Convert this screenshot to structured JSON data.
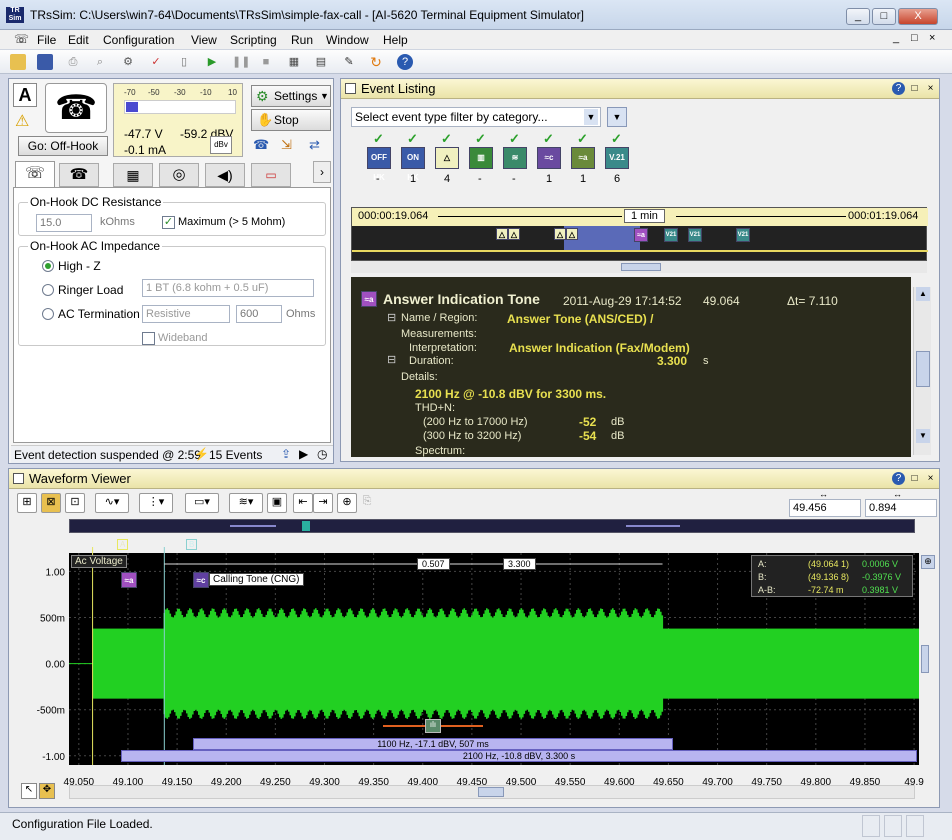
{
  "window": {
    "logo": "TR Sim",
    "title": "TRsSim:  C:\\Users\\win7-64\\Documents\\TRsSim\\simple-fax-call - [AI-5620  Terminal Equipment Simulator]",
    "min": "_",
    "max": "□",
    "close": "X"
  },
  "menu": [
    "File",
    "Edit",
    "Configuration",
    "View",
    "Scripting",
    "Run",
    "Window",
    "Help"
  ],
  "mdi_buttons": [
    "_",
    "□",
    "×"
  ],
  "left_panel": {
    "a_label": "A",
    "go_button": "Go:  Off-Hook",
    "meter_ticks": [
      "-70",
      "-50",
      "-30",
      "-10",
      "10"
    ],
    "voltage": "-47.7  V",
    "current": "-0.1 mA",
    "dbv": "-59.2 dBV",
    "dbv_btn": "dBv",
    "settings_button": "Settings",
    "stop_button": "Stop",
    "dc_group": {
      "title": "On-Hook DC Resistance",
      "value": "15.0",
      "unit": "kOhms",
      "maximum_label": "Maximum (> 5 Mohm)"
    },
    "ac_group": {
      "title": "On-Hook AC Impedance",
      "options": [
        "High - Z",
        "Ringer Load",
        "AC Termination"
      ],
      "ringer_value": "1 BT (6.8 kohm + 0.5 uF)",
      "termination_value": "Resistive",
      "termination_ohms": "600",
      "ohms_unit": "Ohms",
      "wideband_label": "Wideband"
    },
    "status_text": "Event detection suspended @ 2:59",
    "events_count": "15 Events"
  },
  "event_listing": {
    "title": "Event Listing",
    "filter_placeholder": "Select event type filter by category...",
    "categories": [
      {
        "icon": "OFF HK",
        "count": "-"
      },
      {
        "icon": "ON HK",
        "count": "1"
      },
      {
        "icon": "△",
        "count": "4"
      },
      {
        "icon": "▥",
        "count": "-"
      },
      {
        "icon": "≋",
        "count": "-"
      },
      {
        "icon": "≈c",
        "count": "1"
      },
      {
        "icon": "≈a",
        "count": "1"
      },
      {
        "icon": "V.21",
        "count": "6"
      }
    ],
    "timeline_start": "000:00:19.064",
    "timeline_span": "1 min",
    "timeline_end": "000:01:19.064",
    "detail": {
      "name": "Answer Indication Tone",
      "date": "2011-Aug-29  17:14:52",
      "time": "49.064",
      "delta": "Δt= 7.110",
      "name_region_label": "Name / Region:",
      "name_region_value": "Answer Tone (ANS/CED)  /",
      "measurements_label": "Measurements:",
      "interpretation_label": "Interpretation:",
      "interpretation_value": "Answer Indication (Fax/Modem)",
      "duration_label": "Duration:",
      "duration_value": "3.300",
      "duration_unit": "s",
      "details_label": "Details:",
      "details_value": "2100 Hz  @  -10.8 dBV  for 3300 ms.",
      "thd_label": "THD+N:",
      "thd_rows": [
        {
          "range": "(200 Hz to 17000 Hz)",
          "value": "-52",
          "unit": "dB"
        },
        {
          "range": "(300 Hz to 3200 Hz)",
          "value": "-54",
          "unit": "dB"
        }
      ],
      "spectrum_label": "Spectrum:"
    }
  },
  "waveform": {
    "title": "Waveform Viewer",
    "field1": "49.456",
    "field2": "0.894",
    "channel_label": "Ac Voltage",
    "cursor_a": "A",
    "cursor_b": "B",
    "calling_tone": "Calling Tone (CNG)",
    "measure_ab": "0.507",
    "measure_2": "3.300",
    "readout": [
      {
        "label": "A:",
        "time": "(49.064 1)",
        "value": "0.0006  V"
      },
      {
        "label": "B:",
        "time": "(49.136 8)",
        "value": "-0.3976  V"
      },
      {
        "label": "A-B:",
        "time": "-72.74 m",
        "value": "0.3981  V"
      }
    ],
    "bar1": "1100 Hz, -17.1 dBV, 507 ms",
    "bar2": "2100 Hz, -10.8 dBV, 3.300 s",
    "y_ticks": [
      "1.00",
      "500m",
      "0.00",
      "-500m",
      "-1.00"
    ],
    "x_ticks": [
      "49.050",
      "49.100",
      "49.150",
      "49.200",
      "49.250",
      "49.300",
      "49.350",
      "49.400",
      "49.450",
      "49.500",
      "49.550",
      "49.600",
      "49.650",
      "49.700",
      "49.750",
      "49.800",
      "49.850",
      "49.9"
    ]
  },
  "status": "Configuration File Loaded.",
  "colors": {
    "wave": "#22d022",
    "bar": "#b8b4f0",
    "panel_title": "#f3eec0"
  }
}
